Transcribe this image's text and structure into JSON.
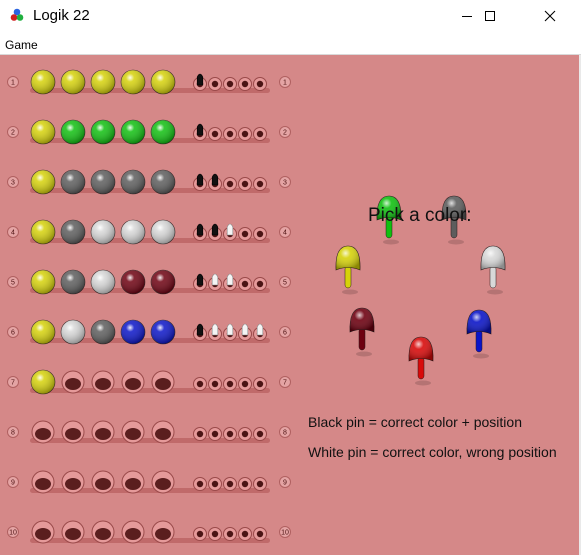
{
  "window": {
    "title": "Logik 22"
  },
  "menu": {
    "game": "Game"
  },
  "board": {
    "background": "#d58888",
    "rows": [
      {
        "number": "1",
        "pegs": [
          "yellow",
          "yellow",
          "yellow",
          "yellow",
          "yellow"
        ],
        "pins": [
          "black",
          "empty",
          "empty",
          "empty",
          "empty"
        ]
      },
      {
        "number": "2",
        "pegs": [
          "yellow",
          "green",
          "green",
          "green",
          "green"
        ],
        "pins": [
          "black",
          "empty",
          "empty",
          "empty",
          "empty"
        ]
      },
      {
        "number": "3",
        "pegs": [
          "yellow",
          "gray",
          "gray",
          "gray",
          "gray"
        ],
        "pins": [
          "black",
          "black",
          "empty",
          "empty",
          "empty"
        ]
      },
      {
        "number": "4",
        "pegs": [
          "yellow",
          "gray",
          "white",
          "white",
          "white"
        ],
        "pins": [
          "black",
          "black",
          "white",
          "empty",
          "empty"
        ]
      },
      {
        "number": "5",
        "pegs": [
          "yellow",
          "gray",
          "white",
          "darkred",
          "darkred"
        ],
        "pins": [
          "black",
          "white",
          "white",
          "empty",
          "empty"
        ]
      },
      {
        "number": "6",
        "pegs": [
          "yellow",
          "white",
          "gray",
          "blue",
          "blue"
        ],
        "pins": [
          "black",
          "white",
          "white",
          "white",
          "white"
        ]
      },
      {
        "number": "7",
        "pegs": [
          "yellow",
          "empty",
          "empty",
          "empty",
          "empty"
        ],
        "pins": [
          "empty",
          "empty",
          "empty",
          "empty",
          "empty"
        ]
      },
      {
        "number": "8",
        "pegs": [
          "empty",
          "empty",
          "empty",
          "empty",
          "empty"
        ],
        "pins": [
          "empty",
          "empty",
          "empty",
          "empty",
          "empty"
        ]
      },
      {
        "number": "9",
        "pegs": [
          "empty",
          "empty",
          "empty",
          "empty",
          "empty"
        ],
        "pins": [
          "empty",
          "empty",
          "empty",
          "empty",
          "empty"
        ]
      },
      {
        "number": "10",
        "pegs": [
          "empty",
          "empty",
          "empty",
          "empty",
          "empty"
        ],
        "pins": [
          "empty",
          "empty",
          "empty",
          "empty",
          "empty"
        ]
      }
    ]
  },
  "palette": {
    "prompt": "Pick a color:",
    "colors": [
      "green",
      "gray",
      "yellow",
      "white",
      "darkred",
      "red",
      "blue"
    ]
  },
  "legend": {
    "black_pin": "Black pin = correct color + position",
    "white_pin": "White pin = correct color, wrong position"
  },
  "colors": {
    "yellow": "#d6d20a",
    "green": "#10c010",
    "gray": "#5d5d5d",
    "white": "#d8d8d8",
    "darkred": "#6e0010",
    "blue": "#0a14c8",
    "red": "#d80a0a"
  }
}
